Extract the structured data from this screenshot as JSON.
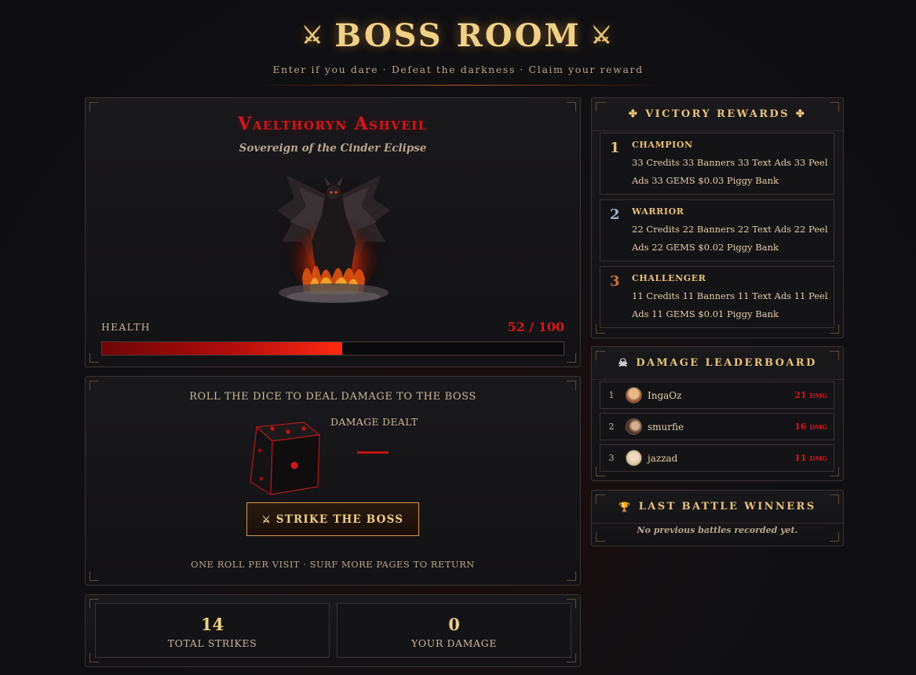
{
  "header": {
    "title": "BOSS ROOM",
    "subtitle": "Enter if you dare · Defeat the darkness · Claim your reward"
  },
  "boss": {
    "name": "Vaelthoryn Ashveil",
    "epithet": "Sovereign of the Cinder Eclipse",
    "health_label": "HEALTH",
    "health_text": "52 / 100",
    "health_current": 52,
    "health_max": 100
  },
  "dice": {
    "title": "ROLL THE DICE TO DEAL DAMAGE TO THE BOSS",
    "damage_label": "DAMAGE DEALT",
    "strike_label": "STRIKE THE BOSS",
    "note": "ONE ROLL PER VISIT · SURF MORE PAGES TO RETURN"
  },
  "stats": {
    "total_strikes": "14",
    "total_strikes_label": "TOTAL STRIKES",
    "your_damage": "0",
    "your_damage_label": "YOUR DAMAGE"
  },
  "rewards": {
    "title": "VICTORY REWARDS",
    "tiers": [
      {
        "rank": "1",
        "title": "CHAMPION",
        "items": "33 Credits  33 Banners  33 Text Ads  33 Peel Ads  33 GEMS  $0.03 Piggy Bank",
        "color": "#e8c27a"
      },
      {
        "rank": "2",
        "title": "WARRIOR",
        "items": "22 Credits  22 Banners  22 Text Ads  22 Peel Ads  22 GEMS  $0.02 Piggy Bank",
        "color": "#9fb3d6"
      },
      {
        "rank": "3",
        "title": "CHALLENGER",
        "items": "11 Credits  11 Banners  11 Text Ads  11 Peel Ads  11 GEMS  $0.01 Piggy Bank",
        "color": "#d0753a"
      }
    ]
  },
  "leaderboard": {
    "title": "DAMAGE LEADERBOARD",
    "rows": [
      {
        "rank": "1",
        "name": "IngaOz",
        "damage": "21 dmg"
      },
      {
        "rank": "2",
        "name": "smurfie",
        "damage": "16 dmg"
      },
      {
        "rank": "3",
        "name": "jazzad",
        "damage": "11 dmg"
      }
    ]
  },
  "last_winners": {
    "title": "LAST BATTLE WINNERS",
    "empty": "No previous battles recorded yet."
  },
  "colors": {
    "accent_gold": "#e8c27a",
    "boss_red": "#d4161a",
    "background": "#111013"
  }
}
